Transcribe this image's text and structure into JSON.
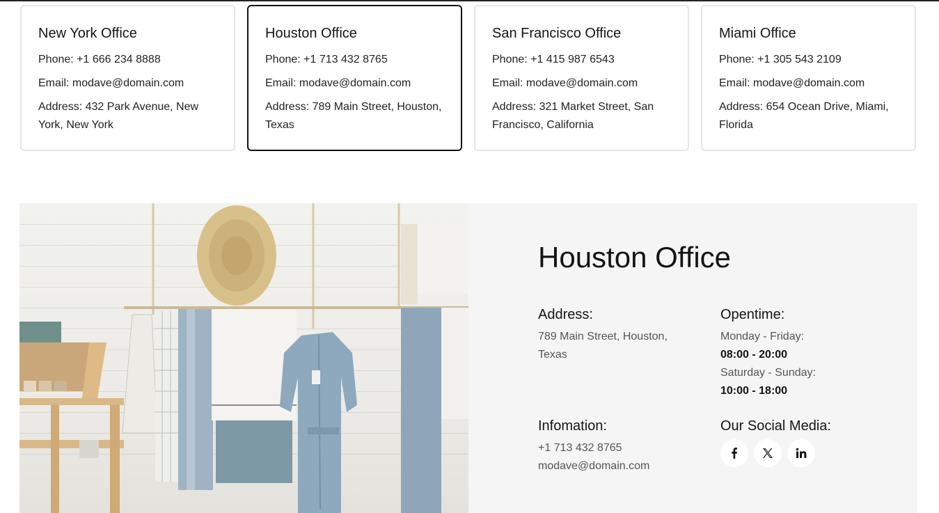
{
  "offices": [
    {
      "title": "New York Office",
      "phone": "Phone: +1 666 234 8888",
      "email": "Email: modave@domain.com",
      "address": "Address: 432 Park Avenue, New York, New York"
    },
    {
      "title": "Houston Office",
      "phone": "Phone: +1 713 432 8765",
      "email": "Email: modave@domain.com",
      "address": "Address: 789 Main Street, Houston, Texas"
    },
    {
      "title": "San Francisco Office",
      "phone": "Phone: +1 415 987 6543",
      "email": "Email: modave@domain.com",
      "address": "Address: 321 Market Street, San Francisco, California"
    },
    {
      "title": "Miami Office",
      "phone": "Phone: +1 305 543 2109",
      "email": "Email: modave@domain.com",
      "address": "Address: 654 Ocean Drive, Miami, Florida"
    }
  ],
  "detail": {
    "title": "Houston Office",
    "address_heading": "Address:",
    "address_text": "789 Main Street, Houston, Texas",
    "opentime_heading": "Opentime:",
    "weekday_label": "Monday - Friday:",
    "weekday_hours": "08:00 - 20:00",
    "weekend_label": "Saturday - Sunday:",
    "weekend_hours": "10:00 - 18:00",
    "info_heading": "Infomation:",
    "info_phone": "+1 713 432 8765",
    "info_email": "modave@domain.com",
    "social_heading": "Our Social Media:",
    "social": [
      "facebook-icon",
      "x-icon",
      "linkedin-icon"
    ]
  },
  "colors": {
    "panel_bg": "#f5f5f5",
    "active_border": "#111111",
    "card_border": "#e6e6e6"
  }
}
